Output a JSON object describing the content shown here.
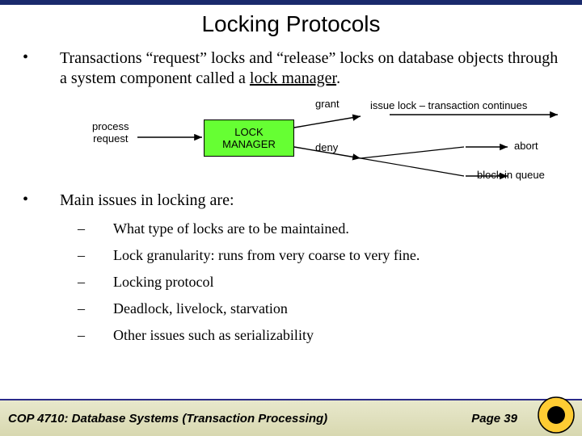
{
  "title": "Locking Protocols",
  "bullet1_pre": "Transactions “request” locks and “release” locks on database objects through a system component called a ",
  "bullet1_underlined": "lock manager",
  "bullet1_post": ".",
  "diagram": {
    "process_request": "process\nrequest",
    "lock_manager": "LOCK\nMANAGER",
    "grant": "grant",
    "deny": "deny",
    "issue": "issue lock – transaction continues",
    "abort": "abort",
    "block": "block in queue"
  },
  "bullet2": "Main issues in locking are:",
  "sub": [
    "What type of locks are to be maintained.",
    "Lock granularity: runs from very coarse to very fine.",
    "Locking protocol",
    "Deadlock, livelock, starvation",
    "Other issues such as serializability"
  ],
  "footer_course": "COP 4710: Database Systems  (Transaction Processing)",
  "footer_page": "Page 39"
}
